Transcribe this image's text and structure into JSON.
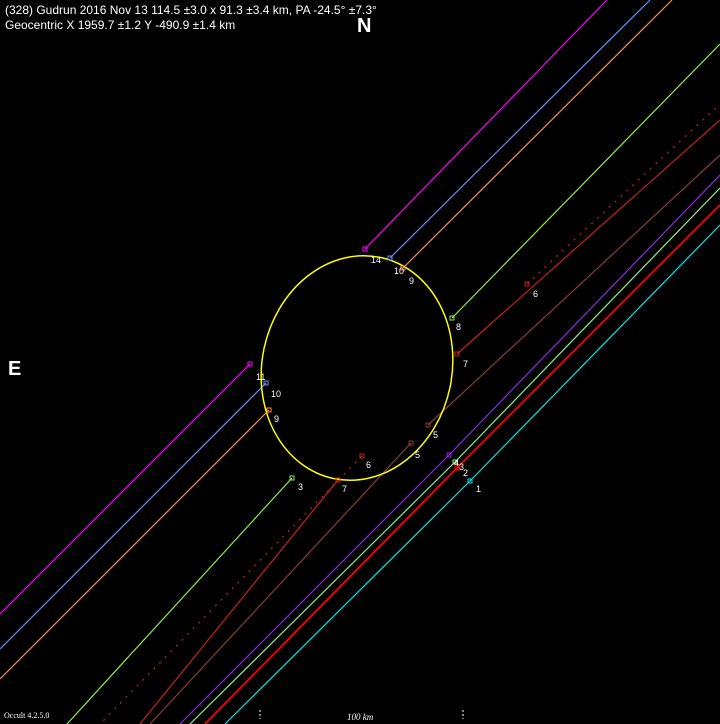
{
  "header": {
    "line1": "(328) Gudrun  2016 Nov 13   114.5 ±3.0 x 91.3 ±3.4 km,  PA -24.5° ±7.3°",
    "line2": "Geocentric  X  1959.7 ±1.2  Y -490.9 ±1.4 km"
  },
  "directions": {
    "north": "N",
    "east": "E"
  },
  "footer": {
    "program": "Occult 4.2.5.0",
    "scale_label": "100 km"
  },
  "colors": {
    "background": "#000000",
    "ellipse": "#ffff00",
    "text": "#ffffff"
  },
  "chords": [
    {
      "label": "14",
      "color": "#ff00ff",
      "style": "solid"
    },
    {
      "label": "11",
      "color": "#ff00ff",
      "style": "solid"
    },
    {
      "label": "10",
      "color": "#6b8cff",
      "style": "solid"
    },
    {
      "label": "10",
      "color": "#6b8cff",
      "style": "solid"
    },
    {
      "label": "9",
      "color": "#ff8c5a",
      "style": "solid"
    },
    {
      "label": "9",
      "color": "#ff8c5a",
      "style": "solid"
    },
    {
      "label": "8",
      "color": "#90ee40",
      "style": "solid"
    },
    {
      "label": "3",
      "color": "#90ee40",
      "style": "solid"
    },
    {
      "label": "6",
      "color": "#c82020",
      "style": "dotted"
    },
    {
      "label": "6",
      "color": "#c82020",
      "style": "dotted"
    },
    {
      "label": "7",
      "color": "#c82020",
      "style": "solid"
    },
    {
      "label": "7",
      "color": "#c82020",
      "style": "solid"
    },
    {
      "label": "5",
      "color": "#8b3a3a",
      "style": "solid"
    },
    {
      "label": "5",
      "color": "#8b3a3a",
      "style": "solid"
    },
    {
      "label": "4",
      "color": "#8a2be2",
      "style": "solid"
    },
    {
      "label": "3",
      "color": "#90ee90",
      "style": "solid"
    },
    {
      "label": "2",
      "color": "#ff0000",
      "style": "solid"
    },
    {
      "label": "1",
      "color": "#00e5e5",
      "style": "solid"
    }
  ]
}
